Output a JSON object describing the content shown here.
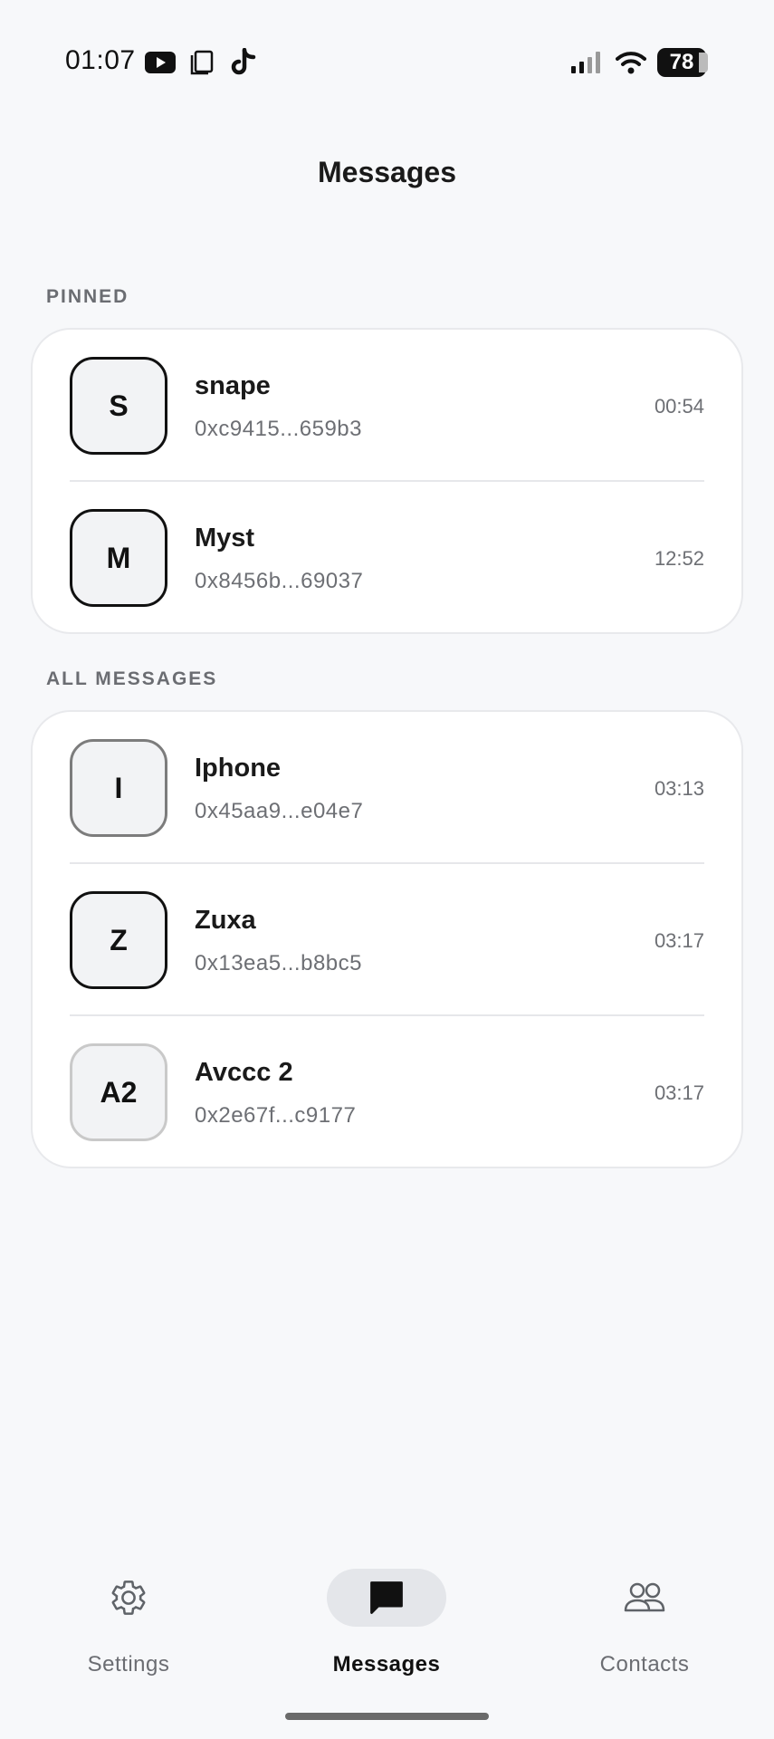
{
  "status_bar": {
    "time": "01:07",
    "icons": [
      "youtube-icon",
      "tablet-icon",
      "tiktok-icon",
      "signal-icon",
      "wifi-icon"
    ],
    "battery": "78"
  },
  "header": {
    "title": "Messages"
  },
  "pinned": {
    "label": "PINNED",
    "items": [
      {
        "initials": "S",
        "name": "snape",
        "address": "0xc9415...659b3",
        "time": "00:54"
      },
      {
        "initials": "M",
        "name": "Myst",
        "address": "0x8456b...69037",
        "time": "12:52"
      }
    ]
  },
  "all_messages": {
    "label": "ALL MESSAGES",
    "items": [
      {
        "initials": "I",
        "name": "Iphone",
        "address": "0x45aa9...e04e7",
        "time": "03:13"
      },
      {
        "initials": "Z",
        "name": "Zuxa",
        "address": "0x13ea5...b8bc5",
        "time": "03:17"
      },
      {
        "initials": "A2",
        "name": "Avccc 2",
        "address": "0x2e67f...c9177",
        "time": "03:17"
      }
    ]
  },
  "bottom_nav": {
    "items": [
      {
        "label": "Settings",
        "icon": "gear-icon"
      },
      {
        "label": "Messages",
        "icon": "chat-bubble-icon",
        "active": true
      },
      {
        "label": "Contacts",
        "icon": "people-icon"
      }
    ]
  },
  "colors": {
    "background": "#f7f8fa",
    "card": "#ffffff",
    "text_primary": "#111111",
    "text_secondary": "#6d6f74",
    "nav_active_pill": "#e4e6ea"
  }
}
